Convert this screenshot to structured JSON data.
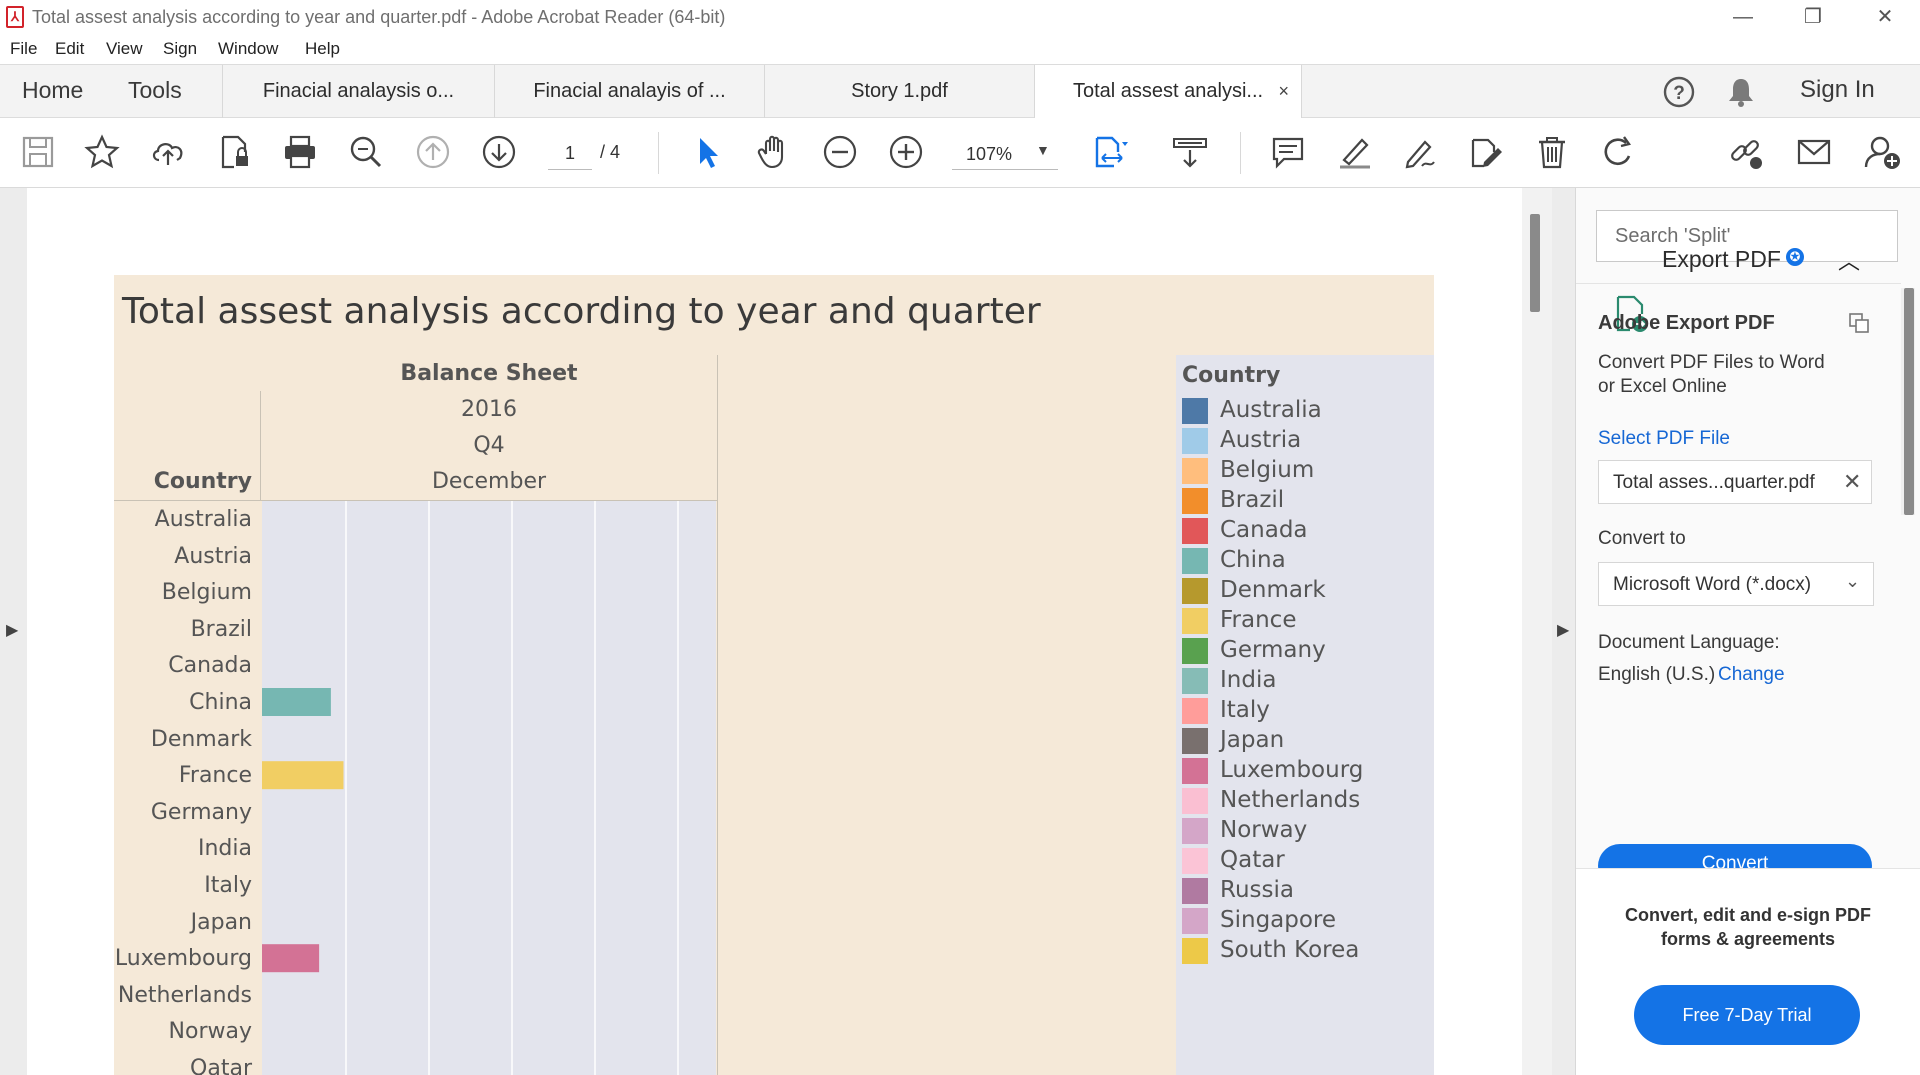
{
  "window": {
    "title": "Total assest analysis according to year and quarter.pdf - Adobe Acrobat Reader (64-bit)",
    "minimize": "—",
    "restore": "❐",
    "close": "✕"
  },
  "menu": [
    "File",
    "Edit",
    "View",
    "Sign",
    "Window",
    "Help"
  ],
  "tabs": {
    "home": "Home",
    "tools": "Tools",
    "documents": [
      "Finacial analaysis o...",
      "Finacial analayis of ...",
      "Story 1.pdf",
      "Total assest analysi..."
    ],
    "close_glyph": "×",
    "sign_in": "Sign In"
  },
  "toolbar": {
    "page_current": "1",
    "page_total": "/ 4",
    "zoom": "107%"
  },
  "chart_data": {
    "type": "bar",
    "title": "Total assest analysis according to year and quarter",
    "header": {
      "measure": "Balance Sheet",
      "year": "2016",
      "quarter": "Q4",
      "month": "December",
      "row_header": "Country"
    },
    "categories": [
      "Australia",
      "Austria",
      "Belgium",
      "Brazil",
      "Canada",
      "China",
      "Denmark",
      "France",
      "Germany",
      "India",
      "Italy",
      "Japan",
      "Luxembourg",
      "Netherlands",
      "Norway",
      "Qatar"
    ],
    "values": [
      0,
      0,
      0,
      0,
      0,
      0.82,
      0,
      0.97,
      0,
      0,
      0,
      0,
      0.68,
      0,
      0,
      0
    ],
    "bar_colors": [
      "#4e79a7",
      "#a0cbe8",
      "#ffbe7d",
      "#f28e2b",
      "#e15759",
      "#76b7b2",
      "#b6992d",
      "#f1ce63",
      "#59a14f",
      "#86bcb6",
      "#ff9d9a",
      "#79706e",
      "#d37295",
      "#fabfd2",
      "#d4a6c8",
      "#fbc4d6"
    ],
    "legend": {
      "title": "Country",
      "placement": "right",
      "entries": [
        {
          "name": "Australia",
          "color": "#4e79a7"
        },
        {
          "name": "Austria",
          "color": "#a0cbe8"
        },
        {
          "name": "Belgium",
          "color": "#ffbe7d"
        },
        {
          "name": "Brazil",
          "color": "#f28e2b"
        },
        {
          "name": "Canada",
          "color": "#e15759"
        },
        {
          "name": "China",
          "color": "#76b7b2"
        },
        {
          "name": "Denmark",
          "color": "#b6992d"
        },
        {
          "name": "France",
          "color": "#f1ce63"
        },
        {
          "name": "Germany",
          "color": "#59a14f"
        },
        {
          "name": "India",
          "color": "#86bcb6"
        },
        {
          "name": "Italy",
          "color": "#ff9d9a"
        },
        {
          "name": "Japan",
          "color": "#79706e"
        },
        {
          "name": "Luxembourg",
          "color": "#d37295"
        },
        {
          "name": "Netherlands",
          "color": "#fabfd2"
        },
        {
          "name": "Norway",
          "color": "#d4a6c8"
        },
        {
          "name": "Qatar",
          "color": "#fbc4d6"
        },
        {
          "name": "Russia",
          "color": "#b07aa1"
        },
        {
          "name": "Singapore",
          "color": "#d4a6c8"
        },
        {
          "name": "South Korea",
          "color": "#edc948"
        }
      ]
    },
    "grid": true
  },
  "right_pane": {
    "search_placeholder": "Search 'Split'",
    "export_title": "Export PDF",
    "adobe_export_title": "Adobe Export PDF",
    "description_line1": "Convert PDF Files to Word",
    "description_line2": "or Excel Online",
    "select_file_label": "Select PDF File",
    "selected_file": "Total asses...quarter.pdf",
    "convert_to_label": "Convert to",
    "convert_to_value": "Microsoft Word (*.docx)",
    "doc_language_label": "Document Language:",
    "doc_language_value": "English (U.S.)",
    "change_link": "Change",
    "convert_button": "Convert",
    "promo_line1": "Convert, edit and e-sign PDF",
    "promo_line2": "forms & agreements",
    "trial_button": "Free 7-Day Trial"
  }
}
